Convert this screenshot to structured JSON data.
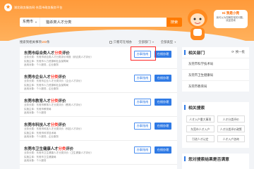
{
  "header": {
    "logo_text": "湖北政务服务网·东莞市政务服务平台",
    "region": "东莞市",
    "search_value": "猎杀类人才分类",
    "search_button": "搜索",
    "bubble_title": "Hi 我是小莞",
    "bubble_text": "我可以为您解答相关问题，欢迎咨询"
  },
  "filters": {
    "count_prefix": "搜索到相关事项",
    "count": "183",
    "count_suffix": "条",
    "opt_only_online": "只看可在线办",
    "opt_dept": "全部部门",
    "opt_type": "全部类型"
  },
  "results": [
    {
      "title_pre": "东莞市综合类人才",
      "title_hl": "分类",
      "title_post": "评价",
      "line1": "业务分类：东莞市综合类人才分类评价申报（综合类人才评价）",
      "line2": "实施主体：东莞市人力资源和社会保障局",
      "line3": "适用对象：个人服务，企业服务"
    },
    {
      "title_pre": "东莞市企业人才",
      "title_hl": "分类",
      "title_post": "评价",
      "line1": "业务分类：东莞市企业人才分类评价（企业人才评价）",
      "line2": "实施主体：东莞市人力资源和社会保障局",
      "line3": "适用对象：个人服务，企业服务"
    },
    {
      "title_pre": "东莞市教育人才",
      "title_hl": "分类",
      "title_post": "评价",
      "line1": "业务分类：东莞市教育人才分类评价（教育人才评价）",
      "line2": "实施主体：东莞市教育局",
      "line3": "适用对象：个人服务"
    },
    {
      "title_pre": "东莞市科技人才",
      "title_hl": "分类",
      "title_post": "评价",
      "line1": "业务分类：东莞市科技人才分类评价（科技人才评价）",
      "line2": "实施主体：东莞市科学技术局",
      "line3": "适用对象：个人服务，企业服务"
    },
    {
      "title_pre": "东莞市卫生健康人才",
      "title_hl": "分类",
      "title_post": "评价",
      "line1": "业务分类：东莞市卫生健康人才分类评价（卫生健康人才评价）",
      "line2": "实施主体：东莞市卫生健康局",
      "line3": "适用对象：个人服务"
    }
  ],
  "result_buttons": {
    "detail": "办事指南",
    "online": "在线办理"
  },
  "side": {
    "dept_title": "相关部门",
    "refresh": "换一批",
    "departments": [
      "东莞市科学技术局",
      "东莞市卫生健康局",
      "东莞市教育局"
    ],
    "search_title": "相关搜索",
    "tags": [
      "人才入户重大事项",
      "人才分类评价",
      "东莞市人才入户",
      "人才分类评价政策",
      "引进人才认定",
      "人才入户咨询"
    ],
    "banner_title": "您对搜索结果是否满意"
  }
}
